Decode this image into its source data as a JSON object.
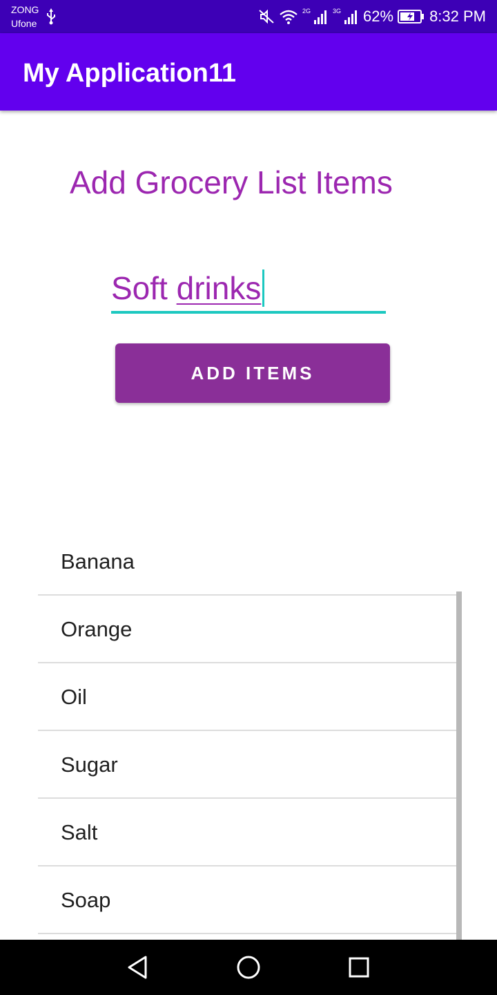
{
  "status_bar": {
    "carrier_1": "ZONG",
    "carrier_2": "Ufone",
    "net_1": "2G",
    "net_2": "3G",
    "battery": "62%",
    "time": "8:32 PM",
    "icons": [
      "usb-icon",
      "mute-icon",
      "wifi-icon",
      "signal-icon",
      "signal-icon",
      "battery-charging-icon"
    ]
  },
  "app_bar": {
    "title": "My Application11"
  },
  "main": {
    "heading": "Add Grocery List Items",
    "input": {
      "word_1": "Soft",
      "word_2": "drinks"
    },
    "button_label": "ADD ITEMS"
  },
  "list": {
    "items": [
      "Banana",
      "Orange",
      "Oil",
      "Sugar",
      "Salt",
      "Soap"
    ]
  },
  "nav_bar": {
    "icons": [
      "back-icon",
      "home-icon",
      "recents-icon"
    ]
  },
  "colors": {
    "status_bar": "#3d00b6",
    "app_bar": "#6200ee",
    "accent_text": "#9c27b0",
    "button": "#8a2f98",
    "input_underline": "#1cc8c0"
  }
}
